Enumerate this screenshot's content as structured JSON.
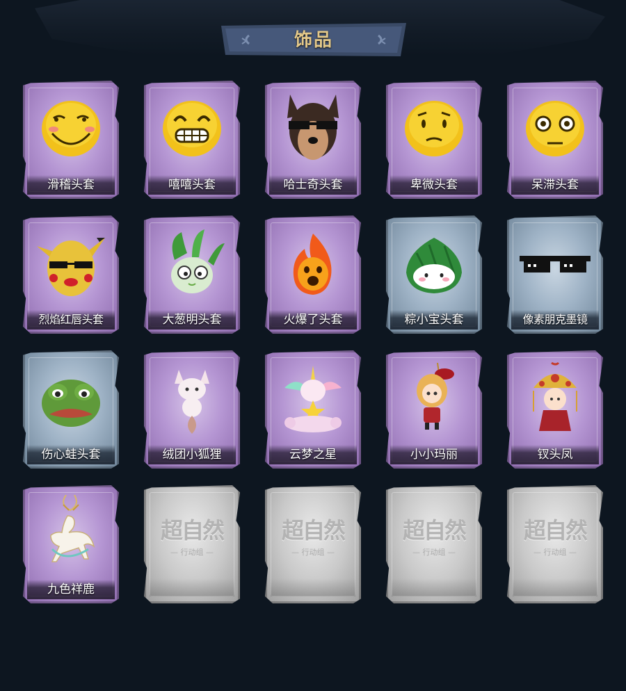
{
  "header": {
    "title": "饰品"
  },
  "items": [
    {
      "label": "滑稽头套",
      "rarity": "purple",
      "icon": "smirk-emoji-icon"
    },
    {
      "label": "嘻嘻头套",
      "rarity": "purple",
      "icon": "grin-emoji-icon"
    },
    {
      "label": "哈士奇头套",
      "rarity": "purple",
      "icon": "husky-icon"
    },
    {
      "label": "卑微头套",
      "rarity": "purple",
      "icon": "humble-emoji-icon"
    },
    {
      "label": "呆滞头套",
      "rarity": "purple",
      "icon": "stunned-emoji-icon"
    },
    {
      "label": "烈焰红唇头套",
      "rarity": "purple",
      "icon": "pikachu-hood-icon"
    },
    {
      "label": "大葱明头套",
      "rarity": "purple",
      "icon": "scallion-icon"
    },
    {
      "label": "火爆了头套",
      "rarity": "purple",
      "icon": "flame-icon"
    },
    {
      "label": "粽小宝头套",
      "rarity": "blue",
      "icon": "zongzi-icon"
    },
    {
      "label": "像素朋克墨镜",
      "rarity": "blue",
      "icon": "pixel-sunglasses-icon"
    },
    {
      "label": "伤心蛙头套",
      "rarity": "blue",
      "icon": "sad-frog-icon"
    },
    {
      "label": "绒团小狐狸",
      "rarity": "purple",
      "icon": "fox-plush-icon"
    },
    {
      "label": "云梦之星",
      "rarity": "purple",
      "icon": "unicorn-cloud-icon"
    },
    {
      "label": "小小玛丽",
      "rarity": "purple",
      "icon": "little-mary-doll-icon"
    },
    {
      "label": "钗头凤",
      "rarity": "purple",
      "icon": "phoenix-crown-icon"
    },
    {
      "label": "九色祥鹿",
      "rarity": "purple",
      "icon": "deer-charm-icon"
    }
  ],
  "placeholders": [
    {
      "logo": "超自然",
      "sub": "— 行动组 —"
    },
    {
      "logo": "超自然",
      "sub": "— 行动组 —"
    },
    {
      "logo": "超自然",
      "sub": "— 行动组 —"
    },
    {
      "logo": "超自然",
      "sub": "— 行动组 —"
    }
  ],
  "colors": {
    "background": "#0d1620",
    "title_gold": "#e4c98a",
    "purple_rarity": "#b596d3",
    "blue_rarity": "#9fb3c6",
    "empty_slot": "#c9c9c9"
  }
}
